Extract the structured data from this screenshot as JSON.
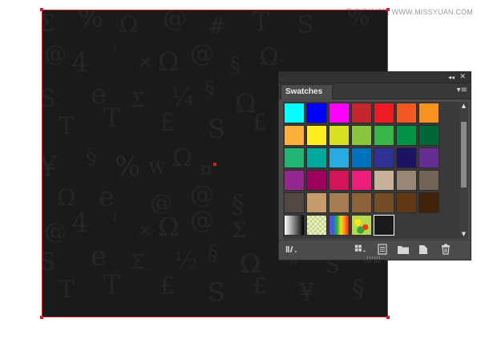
{
  "watermark": "思缘设计论坛  WWW.MISSYUAN.COM",
  "panel": {
    "title": "Swatches",
    "collapse_glyph": "◂◂",
    "close_glyph": "✕",
    "menu_glyph": "▾≡"
  },
  "colors": {
    "artboard_bg": "#1a1a1a",
    "selection": "#c4232a"
  },
  "swatch_rows": [
    [
      "#00ffff",
      "#0000ff",
      "#ff00ff",
      "#c1272d",
      "#ed1c24",
      "#f15a24",
      "#f7931e"
    ],
    [
      "#fbb03b",
      "#fcee21",
      "#d9e021",
      "#8cc63f",
      "#39b54a",
      "#009245",
      "#006837"
    ],
    [
      "#22b573",
      "#00a99d",
      "#29abe2",
      "#0071bc",
      "#2e3192",
      "#1b1464",
      "#662d91"
    ],
    [
      "#93278f",
      "#9e005d",
      "#d4145a",
      "#ed1e79",
      "#c7b299",
      "#998675",
      "#736357"
    ],
    [
      "#534741",
      "#c69c6d",
      "#a67c52",
      "#8c6239",
      "#754c24",
      "#603813",
      "#42210b"
    ]
  ],
  "special_swatches": [
    {
      "name": "swatch-gradient-gray"
    },
    {
      "name": "swatch-pattern-checker"
    },
    {
      "name": "swatch-gradient-rainbow"
    },
    {
      "name": "swatch-pattern-leaves"
    },
    {
      "name": "swatch-dark-texture"
    }
  ]
}
